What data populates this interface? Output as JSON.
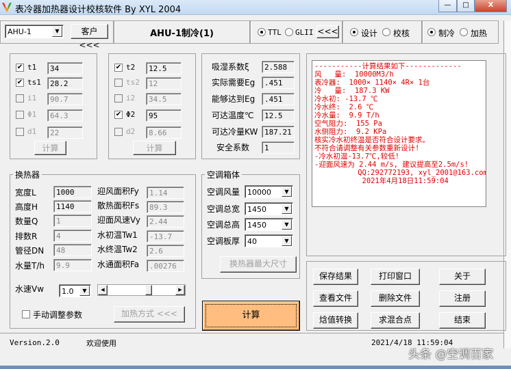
{
  "window": {
    "title": "表冷器加热器设计校核软件  By XYL 2004",
    "min": "—",
    "max": "□",
    "close": "X"
  },
  "toolbar": {
    "unit_select": "AHU-1",
    "client_button": "客户<<<",
    "unit_title": "AHU-1制冷(1)",
    "radio_ttl": "TTL",
    "radio_glii": "GLII",
    "coil_button": "<<<",
    "radio_design": "设计",
    "radio_check": "校核",
    "radio_cool": "制冷",
    "radio_heat": "加热"
  },
  "inlet": {
    "rows": [
      {
        "label": "t1",
        "value": "34",
        "checked": true,
        "enabled": true
      },
      {
        "label": "ts1",
        "value": "28.2",
        "checked": true,
        "enabled": true
      },
      {
        "label": "i1",
        "value": "90.7",
        "checked": false,
        "enabled": false
      },
      {
        "label": "Φ1",
        "value": "64.3",
        "checked": false,
        "enabled": false
      },
      {
        "label": "d1",
        "value": "22",
        "checked": false,
        "enabled": false
      }
    ],
    "button": "计算"
  },
  "outlet": {
    "rows": [
      {
        "label": "t2",
        "value": "12.5",
        "checked": true,
        "enabled": true
      },
      {
        "label": "ts2",
        "value": "12",
        "checked": false,
        "enabled": false
      },
      {
        "label": "i2",
        "value": "34.5",
        "checked": false,
        "enabled": false
      },
      {
        "label": "Φ2",
        "value": "95",
        "checked": true,
        "enabled": true
      },
      {
        "label": "d2",
        "value": "8.66",
        "checked": false,
        "enabled": false
      }
    ],
    "button": "计算"
  },
  "coeffs": {
    "rows": [
      {
        "label": "吸湿系数ξ",
        "value": "2.588"
      },
      {
        "label": "实际需要Eg",
        "value": ".451"
      },
      {
        "label": "能够达到Eg",
        "value": ".451"
      },
      {
        "label": "可达温度℃",
        "value": "12.5"
      },
      {
        "label": "可达冷量KW",
        "value": "187.21"
      },
      {
        "label": "安全系数",
        "value": "1"
      }
    ]
  },
  "exchanger": {
    "title": "换热器",
    "left": [
      {
        "label": "宽度L",
        "value": "1000",
        "enabled": true
      },
      {
        "label": "高度H",
        "value": "1140",
        "enabled": true
      },
      {
        "label": "数量Q",
        "value": "1",
        "enabled": false
      },
      {
        "label": "排数R",
        "value": "4",
        "enabled": false
      },
      {
        "label": "管径DN",
        "value": "48",
        "enabled": false
      },
      {
        "label": "水量T/h",
        "value": "9.9",
        "enabled": false
      }
    ],
    "right": [
      {
        "label": "迎风面积Fy",
        "value": "1.14"
      },
      {
        "label": "散热面积Fs",
        "value": "89.3"
      },
      {
        "label": "迎面风速Vy",
        "value": "2.44"
      },
      {
        "label": "水初温Tw1",
        "value": "-13.7"
      },
      {
        "label": "水终温Tw2",
        "value": "2.6"
      },
      {
        "label": "水通面积Fa",
        "value": ".00276"
      }
    ],
    "water_speed_label": "水速Vw",
    "water_speed": "1.0",
    "water_speed_slider": 0.62,
    "manual_label": "手动调整参数",
    "heat_mode_button": "加热方式 <<<"
  },
  "ahu_box": {
    "title": "空调箱体",
    "rows": [
      {
        "label": "空调风量",
        "value": "10000"
      },
      {
        "label": "空调总宽",
        "value": "1450"
      },
      {
        "label": "空调总高",
        "value": "1450"
      },
      {
        "label": "空调板厚",
        "value": "40"
      }
    ],
    "max_size_button": "换热器最大尺寸"
  },
  "result": {
    "lines": [
      "-----------计算结果如下-------------",
      "风   量:  10000M3/h",
      "表冷器:  1000× 1140× 4R× 1台",
      "冷   量:  187.3 KW",
      "冷水初: -13.7 ℃",
      "冷水终:  2.6 ℃",
      "冷水量:  9.9 T/h",
      "空气阻力:  155 Pa",
      "水侧阻力:  9.2 KPa",
      "核实冷水初终温是否符合设计要求。",
      "不符合请调整有关参数重新设计!",
      "",
      "-冷水初温-13.7℃,较低!",
      "-迎面风速为 2.44 m/s, 建议提高至2.5m/s!",
      "",
      "          QQ:292772193, xyl_2001@163.com",
      "           2021年4月18日11:59:04"
    ]
  },
  "calc_button": "计算",
  "actions": [
    "保存结果",
    "打印窗口",
    "关于",
    "查看文件",
    "删除文件",
    "注册",
    "焓值转换",
    "求混合点",
    "结束"
  ],
  "status": {
    "version": "Version.2.0",
    "welcome": "欢迎使用",
    "datetime": "2021/4/18 11:59:04"
  },
  "watermark": "头条 @空调百家",
  "colors": {
    "calc": "#ffbe80",
    "result_text": "#e00000"
  }
}
